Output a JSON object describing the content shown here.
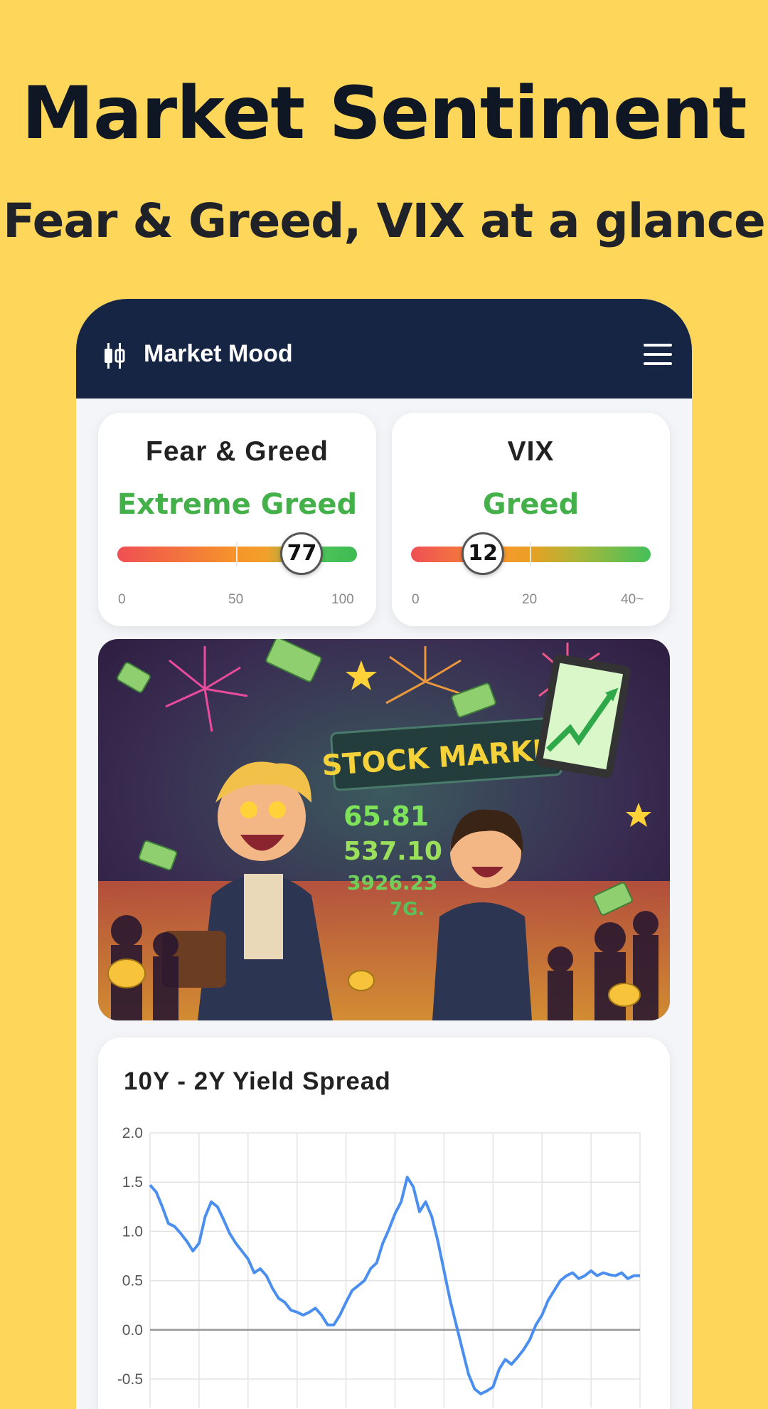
{
  "headline": "Market Sentiment",
  "subheadline": "Fear & Greed, VIX at a glance",
  "app": {
    "title": "Market Mood",
    "logo_icon": "candlestick-icon",
    "menu_icon": "hamburger-menu-icon"
  },
  "fear_greed": {
    "title": "Fear & Greed",
    "state": "Extreme Greed",
    "value": "77",
    "value_num": 77,
    "scale": [
      "0",
      "50",
      "100"
    ],
    "state_color": "#44b04a"
  },
  "vix": {
    "title": "VIX",
    "state": "Greed",
    "value": "12",
    "value_num": 12,
    "scale": [
      "0",
      "20",
      "40~"
    ],
    "state_color": "#44b04a"
  },
  "illustration": {
    "banner": "STOCK MARKET",
    "tickers": [
      "65.81",
      "537.10",
      "3926.23",
      "7G."
    ]
  },
  "chart_data": {
    "type": "line",
    "title": "10Y - 2Y Yield Spread",
    "ylim": [
      -0.5,
      2.0
    ],
    "yticks": [
      "2.0",
      "1.5",
      "1.0",
      "0.5",
      "0.0",
      "-0.5"
    ],
    "grid": true,
    "color": "#4a8ff0",
    "x": [
      0,
      1,
      2,
      3,
      4,
      5,
      6,
      7,
      8,
      9,
      10,
      11,
      12,
      13,
      14,
      15,
      16,
      17,
      18,
      19,
      20,
      21,
      22,
      23,
      24,
      25,
      26,
      27,
      28,
      29,
      30,
      31,
      32,
      33,
      34,
      35,
      36,
      37,
      38,
      39,
      40,
      41,
      42,
      43,
      44,
      45,
      46,
      47,
      48,
      49,
      50,
      51,
      52,
      53,
      54,
      55,
      56,
      57,
      58,
      59,
      60,
      61,
      62,
      63,
      64,
      65,
      66,
      67,
      68,
      69,
      70,
      71,
      72,
      73,
      74,
      75,
      76,
      77,
      78,
      79,
      80
    ],
    "values": [
      1.47,
      1.4,
      1.25,
      1.08,
      1.05,
      0.98,
      0.9,
      0.8,
      0.88,
      1.15,
      1.3,
      1.25,
      1.12,
      0.98,
      0.88,
      0.8,
      0.72,
      0.58,
      0.62,
      0.55,
      0.42,
      0.32,
      0.28,
      0.2,
      0.18,
      0.15,
      0.18,
      0.22,
      0.15,
      0.05,
      0.05,
      0.15,
      0.28,
      0.4,
      0.45,
      0.5,
      0.62,
      0.68,
      0.88,
      1.02,
      1.18,
      1.3,
      1.55,
      1.45,
      1.2,
      1.3,
      1.15,
      0.9,
      0.6,
      0.3,
      0.05,
      -0.2,
      -0.45,
      -0.6,
      -0.65,
      -0.62,
      -0.58,
      -0.4,
      -0.3,
      -0.35,
      -0.28,
      -0.2,
      -0.1,
      0.05,
      0.15,
      0.3,
      0.4,
      0.5,
      0.55,
      0.58,
      0.52,
      0.55,
      0.6,
      0.55,
      0.58,
      0.56,
      0.55,
      0.58,
      0.52,
      0.55,
      0.55
    ]
  }
}
